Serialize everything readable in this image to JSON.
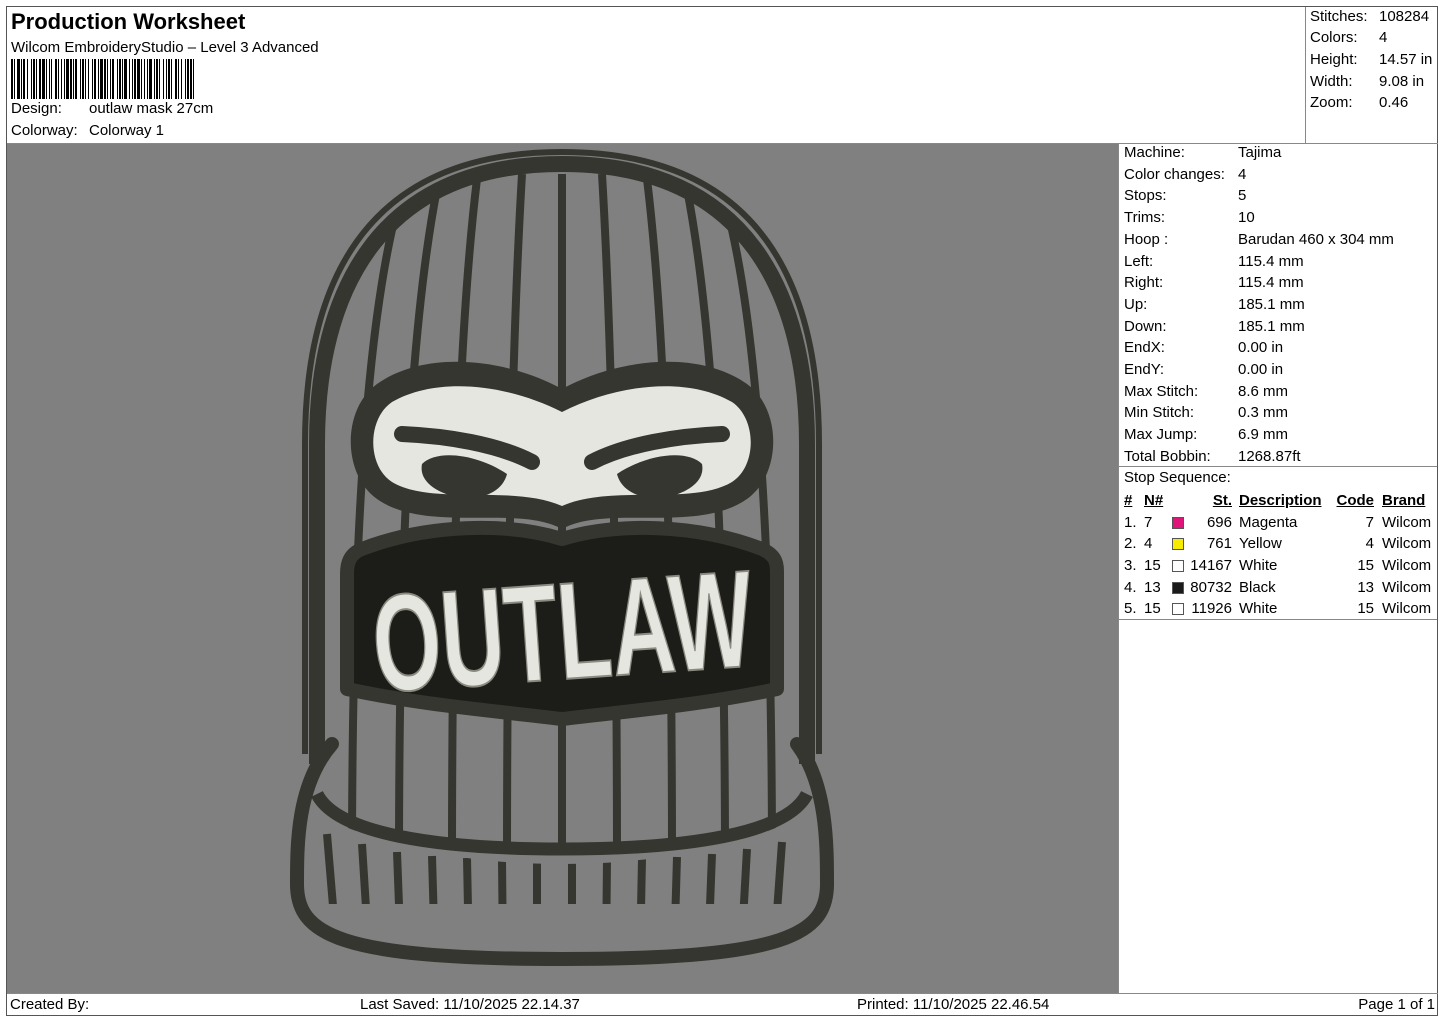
{
  "header": {
    "title": "Production Worksheet",
    "software": "Wilcom EmbroideryStudio – Level 3 Advanced",
    "design_label": "Design:",
    "design_value": "outlaw mask 27cm",
    "colorway_label": "Colorway:",
    "colorway_value": "Colorway 1"
  },
  "summary": [
    {
      "label": "Stitches:",
      "value": "108284"
    },
    {
      "label": "Colors:",
      "value": "4"
    },
    {
      "label": "Height:",
      "value": "14.57 in"
    },
    {
      "label": "Width:",
      "value": "9.08 in"
    },
    {
      "label": "Zoom:",
      "value": "0.46"
    }
  ],
  "machine_info": [
    {
      "label": "Machine:",
      "value": "Tajima"
    },
    {
      "label": "Color changes:",
      "value": "4"
    },
    {
      "label": "Stops:",
      "value": "5"
    },
    {
      "label": "Trims:",
      "value": "10"
    },
    {
      "label": "Hoop :",
      "value": "Barudan 460 x 304 mm"
    },
    {
      "label": "Left:",
      "value": "115.4 mm"
    },
    {
      "label": "Right:",
      "value": "115.4 mm"
    },
    {
      "label": "Up:",
      "value": "185.1 mm"
    },
    {
      "label": "Down:",
      "value": "185.1 mm"
    },
    {
      "label": "EndX:",
      "value": "0.00 in"
    },
    {
      "label": "EndY:",
      "value": "0.00 in"
    },
    {
      "label": "Max Stitch:",
      "value": "8.6 mm"
    },
    {
      "label": "Min Stitch:",
      "value": "0.3 mm"
    },
    {
      "label": "Max Jump:",
      "value": "6.9 mm"
    },
    {
      "label": "Total Bobbin:",
      "value": "1268.87ft"
    }
  ],
  "stop_sequence": {
    "title": "Stop Sequence:",
    "headers": {
      "num": "#",
      "n": "N#",
      "st": "St.",
      "desc": "Description",
      "code": "Code",
      "brand": "Brand"
    },
    "rows": [
      {
        "num": "1.",
        "n": "7",
        "color": "#e0157a",
        "st": "696",
        "desc": "Magenta",
        "code": "7",
        "brand": "Wilcom"
      },
      {
        "num": "2.",
        "n": "4",
        "color": "#f7ec00",
        "st": "761",
        "desc": "Yellow",
        "code": "4",
        "brand": "Wilcom"
      },
      {
        "num": "3.",
        "n": "15",
        "color": "#ffffff",
        "st": "14167",
        "desc": "White",
        "code": "15",
        "brand": "Wilcom"
      },
      {
        "num": "4.",
        "n": "13",
        "color": "#1a1a1a",
        "st": "80732",
        "desc": "Black",
        "code": "13",
        "brand": "Wilcom"
      },
      {
        "num": "5.",
        "n": "15",
        "color": "#ffffff",
        "st": "11926",
        "desc": "White",
        "code": "15",
        "brand": "Wilcom"
      }
    ]
  },
  "design_preview": {
    "text": "OUTLAW",
    "colors": {
      "background": "#808080",
      "outline": "#363630",
      "fill": "#e6e6e0"
    }
  },
  "footer": {
    "created_by": "Created By:",
    "last_saved": "Last Saved: 11/10/2025 22.14.37",
    "printed": "Printed: 11/10/2025 22.46.54",
    "page": "Page 1 of 1"
  }
}
